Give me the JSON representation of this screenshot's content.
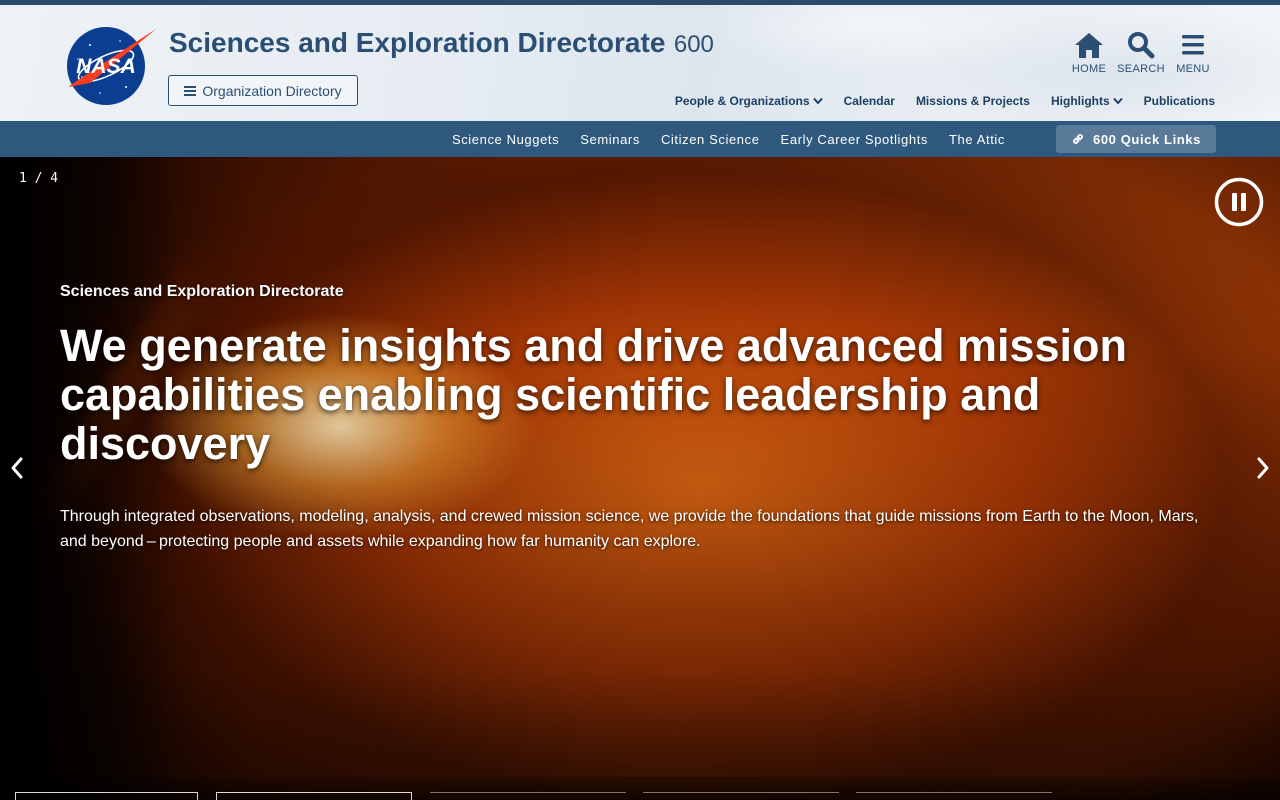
{
  "header": {
    "title": "Sciences and Exploration Directorate",
    "code": "600",
    "org_directory_label": "Organization Directory",
    "logo_text": "NASA",
    "brand_color": "#2a4e74",
    "utility": [
      {
        "icon": "home-icon",
        "label": "HOME"
      },
      {
        "icon": "search-icon",
        "label": "SEARCH"
      },
      {
        "icon": "menu-icon",
        "label": "MENU"
      }
    ],
    "nav": [
      {
        "label": "People & Organizations",
        "has_dropdown": true
      },
      {
        "label": "Calendar",
        "has_dropdown": false
      },
      {
        "label": "Missions & Projects",
        "has_dropdown": false
      },
      {
        "label": "Highlights",
        "has_dropdown": true
      },
      {
        "label": "Publications",
        "has_dropdown": false
      }
    ]
  },
  "subnav": {
    "links": [
      "Science Nuggets",
      "Seminars",
      "Citizen Science",
      "Early Career Spotlights",
      "The Attic"
    ],
    "quick_links_label": "600 Quick Links",
    "bar_color": "#2e587d"
  },
  "hero": {
    "counter": "1 / 4",
    "eyebrow": "Sciences and Exploration Directorate",
    "headline": "We generate insights and drive advanced mission capabilities enabling scientific leadership and discovery",
    "lede": "Through integrated observations, modeling, analysis, and crewed mission science, we provide the foundations that guide missions from Earth to the Moon, Mars, and beyond – protecting people and assets while expanding how far humanity can explore.",
    "current_slide": 1,
    "total_slides": 4
  }
}
